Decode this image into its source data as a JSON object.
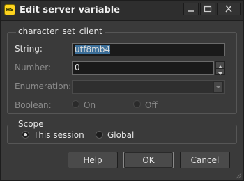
{
  "window": {
    "title": "Edit server variable",
    "app_icon_text": "HS"
  },
  "variable_group": {
    "title": "character_set_client",
    "string": {
      "label": "String:",
      "value": "utf8mb4"
    },
    "number": {
      "label": "Number:",
      "value": "0"
    },
    "enumeration": {
      "label": "Enumeration:",
      "value": ""
    },
    "boolean": {
      "label": "Boolean:",
      "options": [
        "On",
        "Off"
      ]
    }
  },
  "scope_group": {
    "title": "Scope",
    "options": [
      "This session",
      "Global"
    ],
    "selected": "This session"
  },
  "buttons": {
    "help": "Help",
    "ok": "OK",
    "cancel": "Cancel"
  },
  "colors": {
    "window_bg": "#3a3a3a",
    "input_bg": "#1a1a1a",
    "selection": "#3b6e98",
    "app_icon": "#ffd41f"
  }
}
